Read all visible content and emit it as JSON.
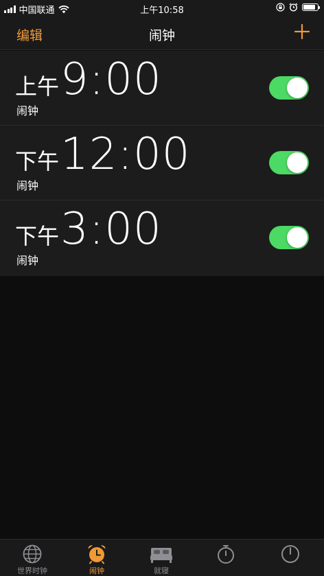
{
  "status_bar": {
    "carrier": "中国联通",
    "time": "上午10:58",
    "battery_level": 0.85
  },
  "nav": {
    "edit_label": "编辑",
    "title": "闹钟",
    "add_icon": "plus-icon"
  },
  "alarms": [
    {
      "period": "上午",
      "time": "9:00",
      "label": "闹钟",
      "enabled": true
    },
    {
      "period": "下午",
      "time": "12:00",
      "label": "闹钟",
      "enabled": true
    },
    {
      "period": "下午",
      "time": "3:00",
      "label": "闹钟",
      "enabled": true
    }
  ],
  "tabs": [
    {
      "label": "世界时钟",
      "icon": "globe-icon",
      "active": false
    },
    {
      "label": "闹钟",
      "icon": "alarm-clock-icon",
      "active": true
    },
    {
      "label": "就寝",
      "icon": "bed-icon",
      "active": false
    },
    {
      "label": "",
      "icon": "stopwatch-icon",
      "active": false
    },
    {
      "label": "",
      "icon": "timer-icon",
      "active": false
    }
  ],
  "colors": {
    "accent": "#f09a37",
    "toggle_on": "#4cd964",
    "background": "#0d0d0d",
    "row_background": "#1c1c1c",
    "bar_background": "#1a1a1a"
  }
}
